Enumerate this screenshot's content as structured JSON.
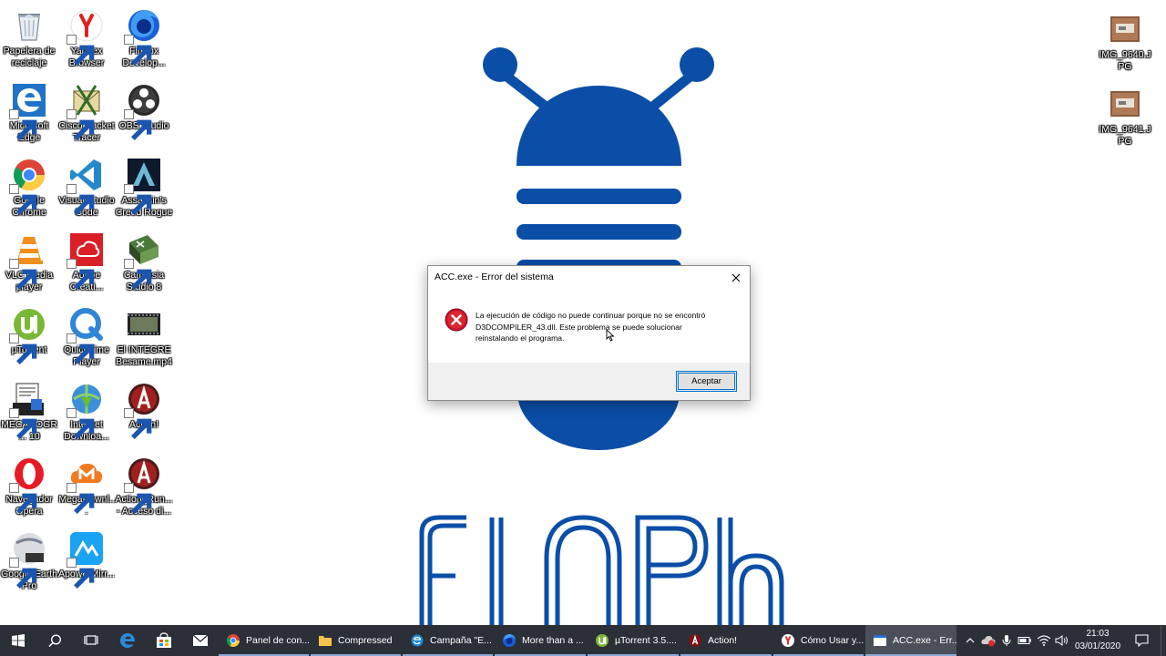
{
  "desktop": {
    "icons_left": [
      {
        "id": "recycle",
        "label": "Papelera de reciclaje",
        "icon": "recycle-bin-icon"
      },
      {
        "id": "yandex",
        "label": "Yandex Browser",
        "icon": "yandex-icon"
      },
      {
        "id": "firefox",
        "label": "Firefox Develop...",
        "icon": "firefox-icon"
      },
      {
        "id": "edge",
        "label": "Microsoft Edge",
        "icon": "edge-icon"
      },
      {
        "id": "cisco",
        "label": "Cisco Packet Tracer",
        "icon": "cisco-packet-tracer-icon"
      },
      {
        "id": "obs",
        "label": "OBS Studio",
        "icon": "obs-icon"
      },
      {
        "id": "chrome",
        "label": "Google Chrome",
        "icon": "chrome-icon"
      },
      {
        "id": "vscode",
        "label": "Visual Studio Code",
        "icon": "vscode-icon"
      },
      {
        "id": "assassins",
        "label": "Assassin's Creed Rogue",
        "icon": "assassins-creed-icon"
      },
      {
        "id": "vlc",
        "label": "VLC media player",
        "icon": "vlc-icon"
      },
      {
        "id": "adobe",
        "label": "Adobe Creati...",
        "icon": "adobe-cc-icon"
      },
      {
        "id": "camtasia",
        "label": "Camtasia Studio 8",
        "icon": "camtasia-icon"
      },
      {
        "id": "utorrent",
        "label": "µTorrent",
        "icon": "utorrent-icon"
      },
      {
        "id": "quicktime",
        "label": "QuickTime Player",
        "icon": "quicktime-icon"
      },
      {
        "id": "video",
        "label": "El INTEGRE Besame.mp4",
        "icon": "video-file-icon"
      },
      {
        "id": "mecano",
        "label": "MECANOGR... 10",
        "icon": "mecanografia-icon"
      },
      {
        "id": "idm",
        "label": "Internet Downloa...",
        "icon": "idm-icon"
      },
      {
        "id": "action",
        "label": "Action!",
        "icon": "action-icon"
      },
      {
        "id": "opera",
        "label": "Navegador Opera",
        "icon": "opera-icon"
      },
      {
        "id": "mega",
        "label": "MegaDownl...",
        "icon": "megadownloader-icon"
      },
      {
        "id": "action_run",
        "label": "Action_Run... - Acceso di...",
        "icon": "action-run-icon"
      },
      {
        "id": "earth",
        "label": "Google Earth Pro",
        "icon": "google-earth-icon"
      },
      {
        "id": "apower",
        "label": "ApowerMirr...",
        "icon": "apowermirror-icon"
      }
    ],
    "icons_right": [
      {
        "id": "img1",
        "label": "IMG_9640.JPG",
        "icon": "image-file-icon"
      },
      {
        "id": "img2",
        "label": "IMG_9641.JPG",
        "icon": "image-file-icon"
      }
    ],
    "wallpaper_brand_color": "#0a4ea8"
  },
  "dialog": {
    "title": "ACC.exe - Error del sistema",
    "message_line1": "La ejecución de código no puede continuar porque no se encontró",
    "message_line2": "D3DCOMPILER_43.dll. Este problema se puede solucionar",
    "message_line3": "reinstalando el programa.",
    "ok_label": "Aceptar",
    "icon": "error-icon"
  },
  "taskbar": {
    "apps": [
      {
        "label": "Panel de con...",
        "icon": "chrome-icon"
      },
      {
        "label": "Compressed",
        "icon": "folder-icon"
      },
      {
        "label": "Campaña \"E...",
        "icon": "ie-icon"
      },
      {
        "label": "More than a ...",
        "icon": "firefox-icon"
      },
      {
        "label": "µTorrent 3.5....",
        "icon": "utorrent-icon"
      },
      {
        "label": "Action!",
        "icon": "action-icon"
      },
      {
        "label": "Cómo Usar y...",
        "icon": "yandex-icon"
      },
      {
        "label": "ACC.exe - Err...",
        "icon": "window-icon"
      }
    ],
    "time": "21:03",
    "date": "03/01/2020"
  }
}
